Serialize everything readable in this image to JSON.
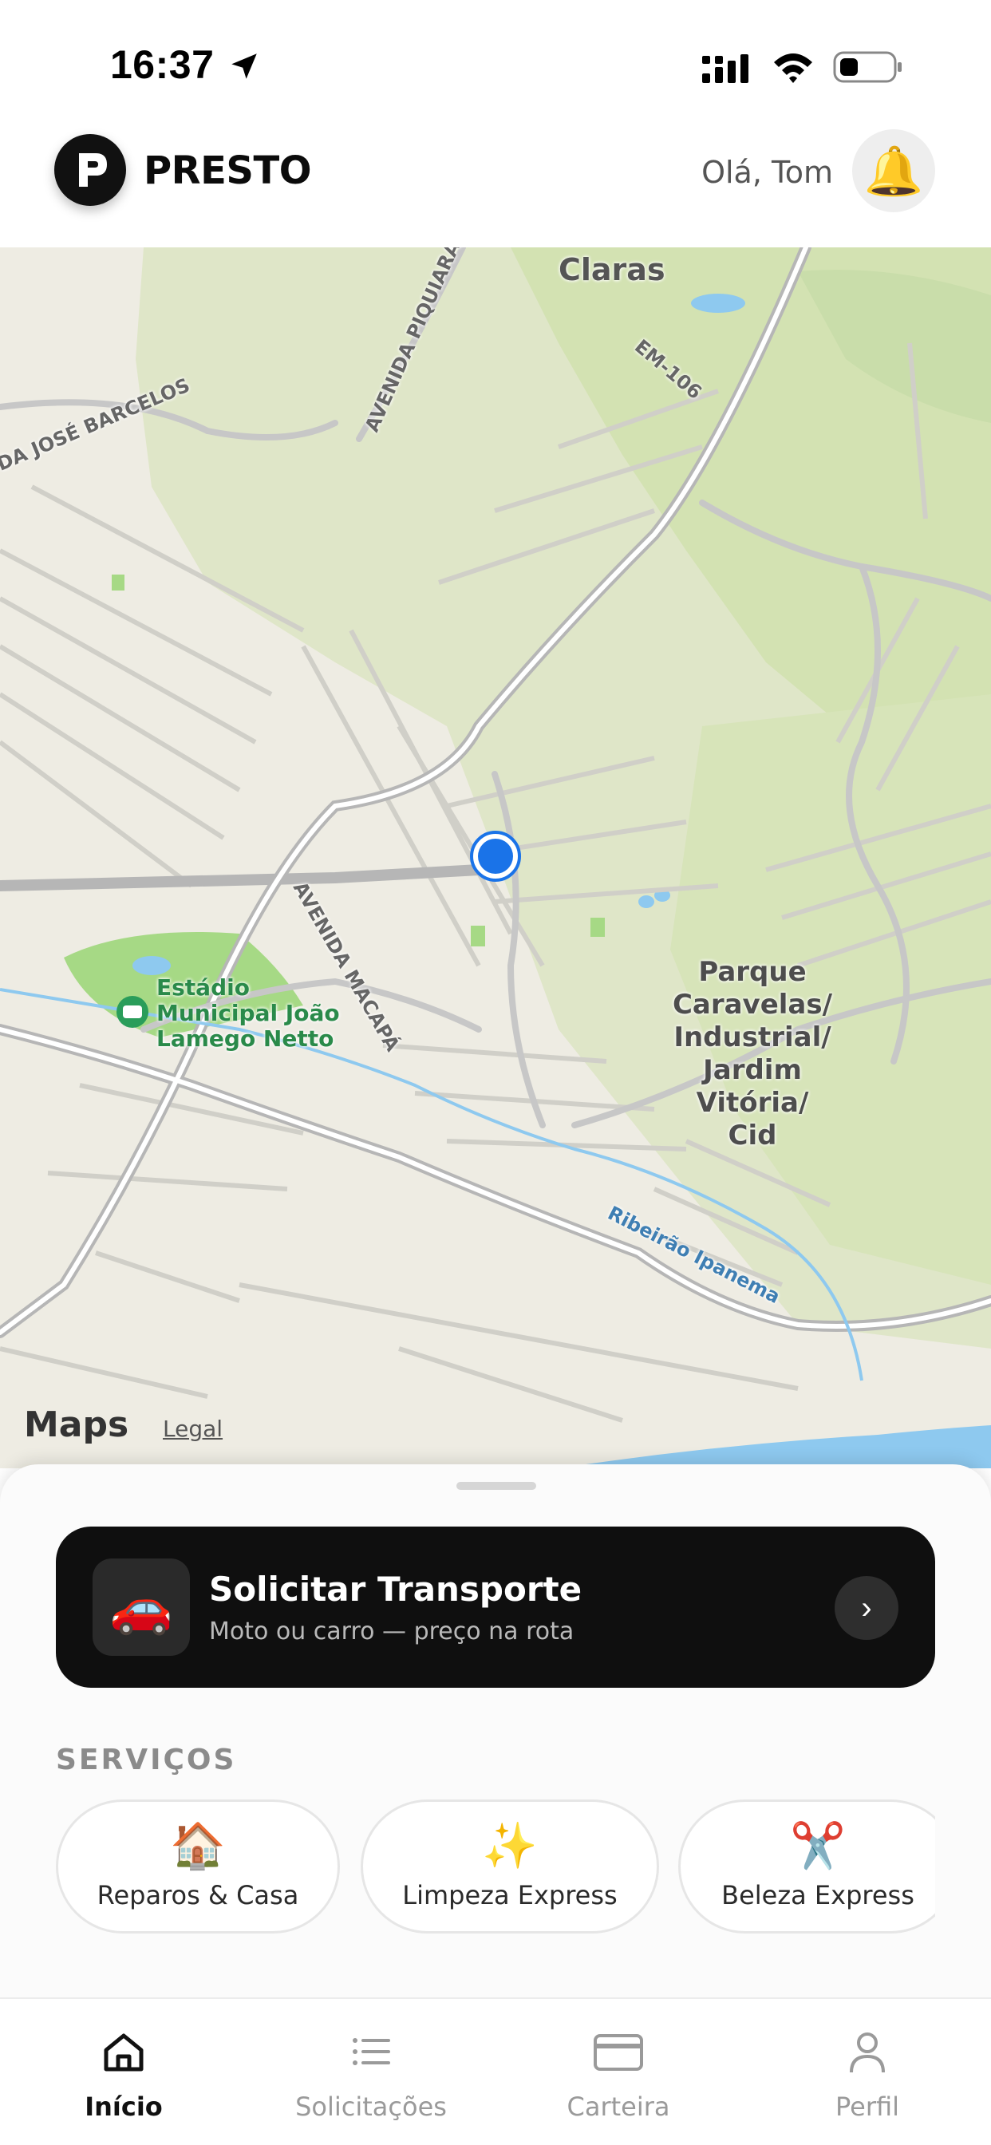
{
  "status_bar": {
    "time": "16:37"
  },
  "header": {
    "brand": "PRESTO",
    "logo_letter": "P",
    "greeting": "Olá, Tom",
    "bell_icon": "🔔"
  },
  "map": {
    "labels": {
      "claras": "Claras",
      "em106": "EM-106",
      "jose_barcelos": "DA JOSÉ BARCELOS",
      "piquiaran": "AVENIDA PIQUIARAN",
      "macapa": "AVENIDA MACAPÁ",
      "estadio": [
        "Estádio",
        "Municipal João",
        "Lamego Netto"
      ],
      "parque": [
        "Parque",
        "Caravelas/",
        "Industrial/",
        "Jardim",
        "Vitória/",
        "Cid"
      ],
      "ribeirao": "Ribeirão Ipanema"
    },
    "attribution": "Maps",
    "legal": "Legal"
  },
  "sheet": {
    "transport": {
      "icon": "🚗",
      "title": "Solicitar Transporte",
      "subtitle": "Moto ou carro — preço na rota",
      "chevron": "›"
    },
    "services_title": "SERVIÇOS",
    "services": [
      {
        "icon": "🏠",
        "label": "Reparos & Casa"
      },
      {
        "icon": "✨",
        "label": "Limpeza Express"
      },
      {
        "icon": "✂️",
        "label": "Beleza Express"
      }
    ]
  },
  "tabbar": {
    "tabs": [
      {
        "label": "Início",
        "icon": "home-icon",
        "active": true
      },
      {
        "label": "Solicitações",
        "icon": "list-icon",
        "active": false
      },
      {
        "label": "Carteira",
        "icon": "card-icon",
        "active": false
      },
      {
        "label": "Perfil",
        "icon": "person-icon",
        "active": false
      }
    ]
  },
  "colors": {
    "accent": "#111111",
    "location_dot": "#1a73e8",
    "park_green": "#d6e6b8",
    "water": "#8ec9ef"
  }
}
